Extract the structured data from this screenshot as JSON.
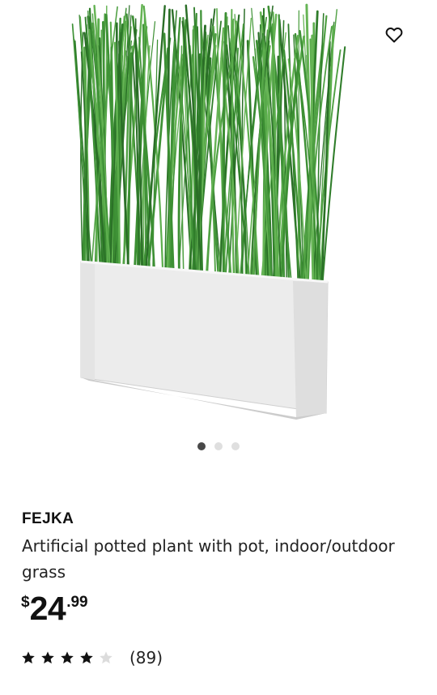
{
  "product": {
    "name": "FEJKA",
    "description": "Artificial potted plant with pot, indoor/outdoor grass",
    "price": {
      "currency": "$",
      "integer": "24",
      "decimals": ".99"
    },
    "rating": {
      "stars": 4,
      "max": 5,
      "count_label": "(89)"
    }
  },
  "gallery": {
    "image_count": 3,
    "active_index": 0
  },
  "icons": {
    "favorite": "heart-outline-icon",
    "rating_star": "star-icon"
  },
  "colors": {
    "active_dot": "#484848",
    "inactive_dot": "#dfdfdf",
    "star_filled": "#111111",
    "star_empty": "#dcdcdc"
  }
}
